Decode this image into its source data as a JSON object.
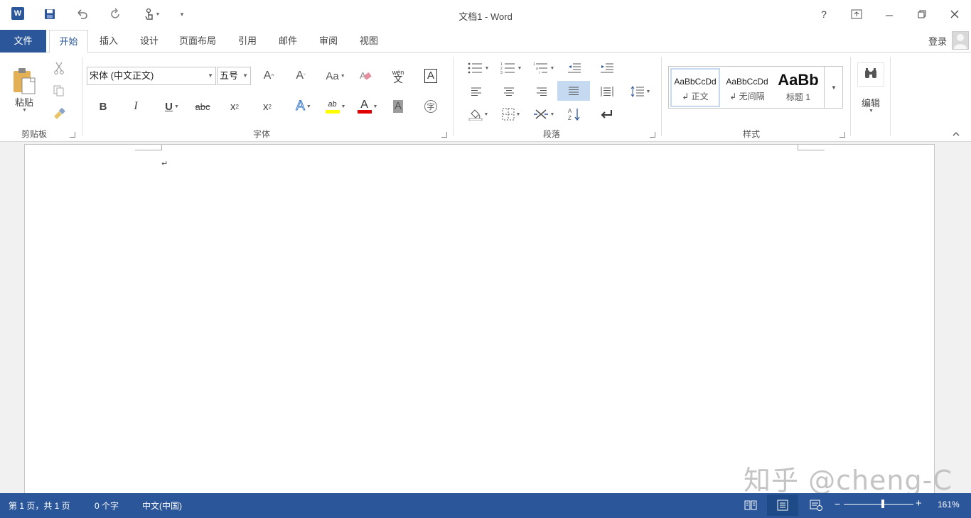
{
  "window": {
    "title": "文档1 - Word",
    "help": "?"
  },
  "tabs": [
    "文件",
    "开始",
    "插入",
    "设计",
    "页面布局",
    "引用",
    "邮件",
    "审阅",
    "视图"
  ],
  "account": {
    "login": "登录"
  },
  "clipboard": {
    "paste": "粘贴",
    "group": "剪贴板"
  },
  "font": {
    "name": "宋体 (中文正文)",
    "size": "五号",
    "group": "字体",
    "wen": "wén",
    "wen_char": "文",
    "abc": "abc",
    "bold": "B",
    "italic": "I",
    "underline": "U",
    "sub": "x",
    "sup": "x",
    "grow": "A",
    "shrink": "A",
    "case": "Aa",
    "color": "A",
    "highlight": "ab",
    "shade": "A",
    "border": "A",
    "circle": "字"
  },
  "paragraph": {
    "group": "段落"
  },
  "styles": {
    "group": "样式",
    "items": [
      {
        "preview": "AaBbCcDd",
        "name": "↲ 正文"
      },
      {
        "preview": "AaBbCcDd",
        "name": "↲ 无间隔"
      },
      {
        "preview": "AaBb",
        "name": "标题 1"
      }
    ]
  },
  "editing": {
    "label": "编辑"
  },
  "document": {
    "paragraph_mark": "↵"
  },
  "status": {
    "page": "第 1 页，共 1 页",
    "words": "0 个字",
    "language": "中文(中国)",
    "zoom": "161%"
  },
  "watermark": "知乎 @cheng-C",
  "colors": {
    "accent": "#2b579a",
    "highlight": "#ffff00",
    "font_red": "#e00000",
    "selected": "#c5d9f1"
  }
}
